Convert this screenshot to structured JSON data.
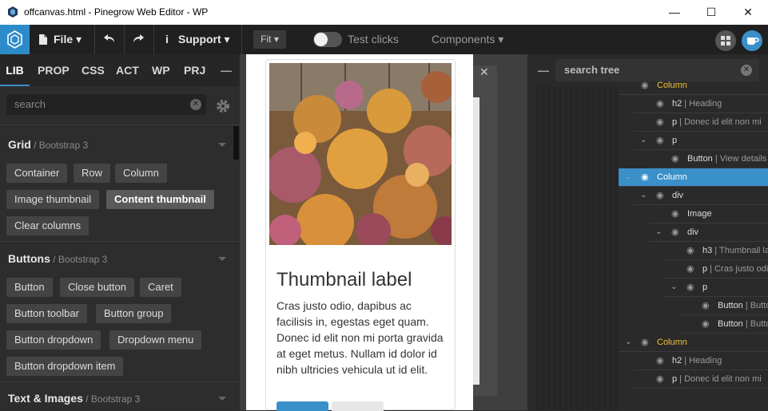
{
  "window": {
    "title": "offcanvas.html - Pinegrow Web Editor - WP",
    "minimize": "—",
    "maximize": "☐",
    "close": "✕"
  },
  "toolbar": {
    "file": "File ▾",
    "support": "Support ▾",
    "fit": "Fit ▾",
    "test_clicks": "Test clicks",
    "components": "Components ▾",
    "info_icon": "i"
  },
  "left_panel": {
    "tabs": [
      "LIB",
      "PROP",
      "CSS",
      "ACT",
      "WP",
      "PRJ"
    ],
    "minimize": "—",
    "search_placeholder": "search",
    "sections": [
      {
        "title": "Grid",
        "sub": " / Bootstrap 3",
        "items": [
          "Container",
          "Row",
          "Column",
          "Image thumbnail",
          "Content thumbnail",
          "Clear columns"
        ]
      },
      {
        "title": "Buttons",
        "sub": " / Bootstrap 3",
        "items": [
          "Button",
          "Close button",
          "Caret",
          "Button toolbar",
          "Button group",
          "Button dropdown",
          "Dropdown menu",
          "Button dropdown item"
        ]
      },
      {
        "title": "Text & Images",
        "sub": " / Bootstrap 3",
        "items": []
      }
    ],
    "selected_item": "Content thumbnail"
  },
  "canvas": {
    "thumbnail_label": "Thumbnail label",
    "thumbnail_text": "Cras justo odio, dapibus ac facilisis in, egestas eget quam. Donec id elit non mi porta gravida at eget metus. Nullam id dolor id nibh ultricies vehicula ut id elit.",
    "close": "✕"
  },
  "tree": {
    "minimize": "—",
    "search_placeholder": "search tree",
    "rows": [
      {
        "label": "Column",
        "note": "",
        "yellow": true,
        "indent": 0,
        "chev": ""
      },
      {
        "label": "h2",
        "note": " | Heading",
        "yellow": false,
        "indent": 1,
        "chev": ""
      },
      {
        "label": "p",
        "note": " | Donec id elit non mi",
        "yellow": false,
        "indent": 1,
        "chev": ""
      },
      {
        "label": "p",
        "note": "",
        "yellow": false,
        "indent": 1,
        "chev": "⌄"
      },
      {
        "label": "Button",
        "note": " | View details",
        "yellow": false,
        "indent": 2,
        "chev": ""
      },
      {
        "label": "Column",
        "note": "",
        "yellow": false,
        "indent": 0,
        "chev": "⌄",
        "selected": true
      },
      {
        "label": "div",
        "note": "",
        "yellow": false,
        "indent": 1,
        "chev": "⌄"
      },
      {
        "label": "Image",
        "note": "",
        "yellow": false,
        "indent": 2,
        "chev": ""
      },
      {
        "label": "div",
        "note": "",
        "yellow": false,
        "indent": 2,
        "chev": "⌄"
      },
      {
        "label": "h3",
        "note": " | Thumbnail label",
        "yellow": false,
        "indent": 3,
        "chev": ""
      },
      {
        "label": "p",
        "note": " | Cras justo odio",
        "yellow": false,
        "indent": 3,
        "chev": ""
      },
      {
        "label": "p",
        "note": "",
        "yellow": false,
        "indent": 3,
        "chev": "⌄"
      },
      {
        "label": "Button",
        "note": " | Button",
        "yellow": false,
        "indent": 4,
        "chev": ""
      },
      {
        "label": "Button",
        "note": " | Button",
        "yellow": false,
        "indent": 4,
        "chev": ""
      },
      {
        "label": "Column",
        "note": "",
        "yellow": true,
        "indent": 0,
        "chev": "⌄"
      },
      {
        "label": "h2",
        "note": " | Heading",
        "yellow": false,
        "indent": 1,
        "chev": ""
      },
      {
        "label": "p",
        "note": " | Donec id elit non mi",
        "yellow": false,
        "indent": 1,
        "chev": ""
      }
    ]
  },
  "colors": {
    "accent": "#3a90c8",
    "highlight": "#f0c030"
  }
}
